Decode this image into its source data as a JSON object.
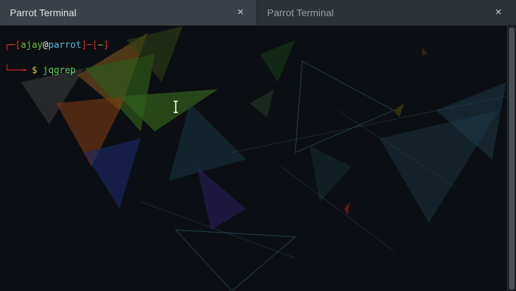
{
  "tabs": [
    {
      "label": "Parrot Terminal",
      "active": true,
      "close_glyph": "×"
    },
    {
      "label": "Parrot Terminal",
      "active": false,
      "close_glyph": "×"
    }
  ],
  "prompt": {
    "corner": "┌─",
    "open_bracket": "[",
    "user": "ajay",
    "at": "@",
    "host": "parrot",
    "close_bracket": "]",
    "dash": "─",
    "dir_open": "[",
    "dir": "~",
    "dir_close": "]",
    "lower_corner": "└──╼",
    "symbol": "$",
    "command": "jqgrep"
  },
  "colors": {
    "prompt_frame": "#e0312b",
    "user": "#68c135",
    "host": "#4fc0e0",
    "dollar": "#e8c33a",
    "command": "#5ad45a"
  }
}
